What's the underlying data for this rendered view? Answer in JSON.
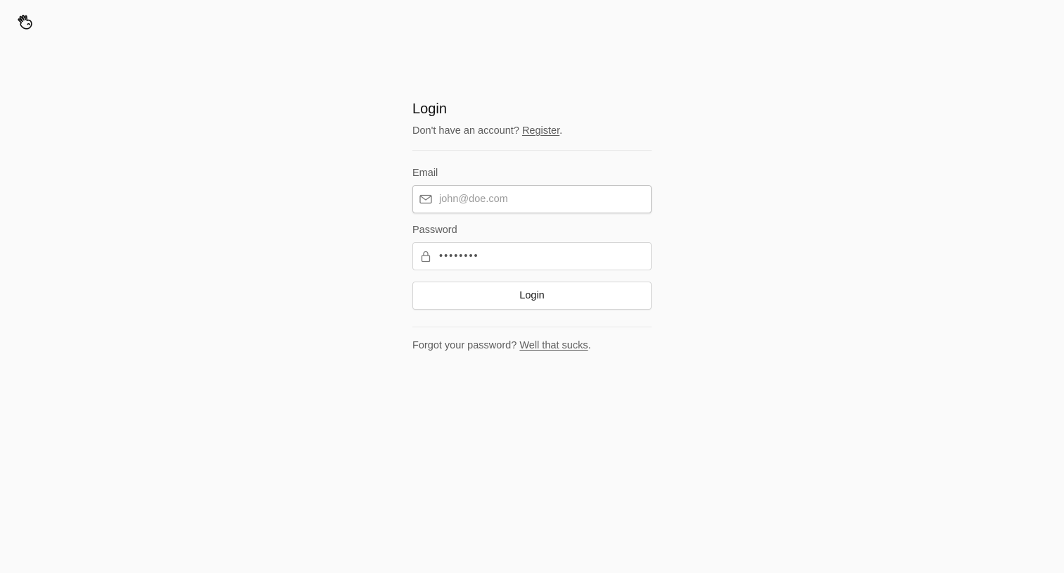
{
  "logo": {
    "icon": "waving-hand-icon"
  },
  "login": {
    "title": "Login",
    "register_prompt": "Don't have an account?",
    "register_link": "Register",
    "register_period": ".",
    "email_label": "Email",
    "email_placeholder": "john@doe.com",
    "email_icon": "mail-icon",
    "password_label": "Password",
    "password_value": "••••••••",
    "password_icon": "lock-icon",
    "submit_label": "Login",
    "forgot_prompt": "Forgot your password?",
    "forgot_link": "Well that sucks",
    "forgot_period": "."
  }
}
